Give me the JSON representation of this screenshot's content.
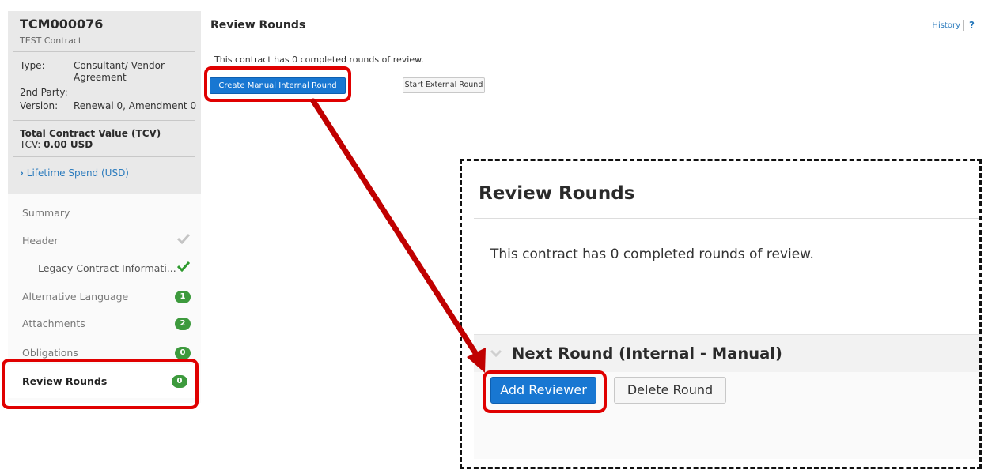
{
  "contract": {
    "id": "TCM000076",
    "name": "TEST Contract",
    "type_label": "Type:",
    "type_value_line1": "Consultant/ Vendor",
    "type_value_line2": "Agreement",
    "party_label": "2nd Party:",
    "version_label": "Version:",
    "version_value": "Renewal 0, Amendment 0",
    "tcv_title": "Total Contract Value (TCV)",
    "tcv_label": "TCV:",
    "tcv_value": "0.00 USD",
    "lifetime_spend": "Lifetime Spend (USD)"
  },
  "nav": {
    "summary": "Summary",
    "header": "Header",
    "legacy": "Legacy Contract Informati...",
    "alt_language": "Alternative Language",
    "alt_language_count": "1",
    "attachments": "Attachments",
    "attachments_count": "2",
    "obligations": "Obligations",
    "obligations_count": "0",
    "review_rounds": "Review Rounds",
    "review_rounds_count": "0"
  },
  "main": {
    "title": "Review Rounds",
    "history": "History",
    "help": "?",
    "description": "This contract has 0 completed rounds of review.",
    "create_manual_button": "Create Manual Internal Round",
    "start_external_button": "Start External Round"
  },
  "zoom": {
    "title": "Review Rounds",
    "description": "This contract has 0 completed rounds of review.",
    "next_round_title": "Next Round (Internal - Manual)",
    "add_reviewer_button": "Add Reviewer",
    "delete_round_button": "Delete Round"
  },
  "colors": {
    "primary_blue": "#1877d2",
    "badge_green": "#3d9a3d",
    "highlight_red": "#e00000",
    "link_blue": "#2b7bbd"
  }
}
